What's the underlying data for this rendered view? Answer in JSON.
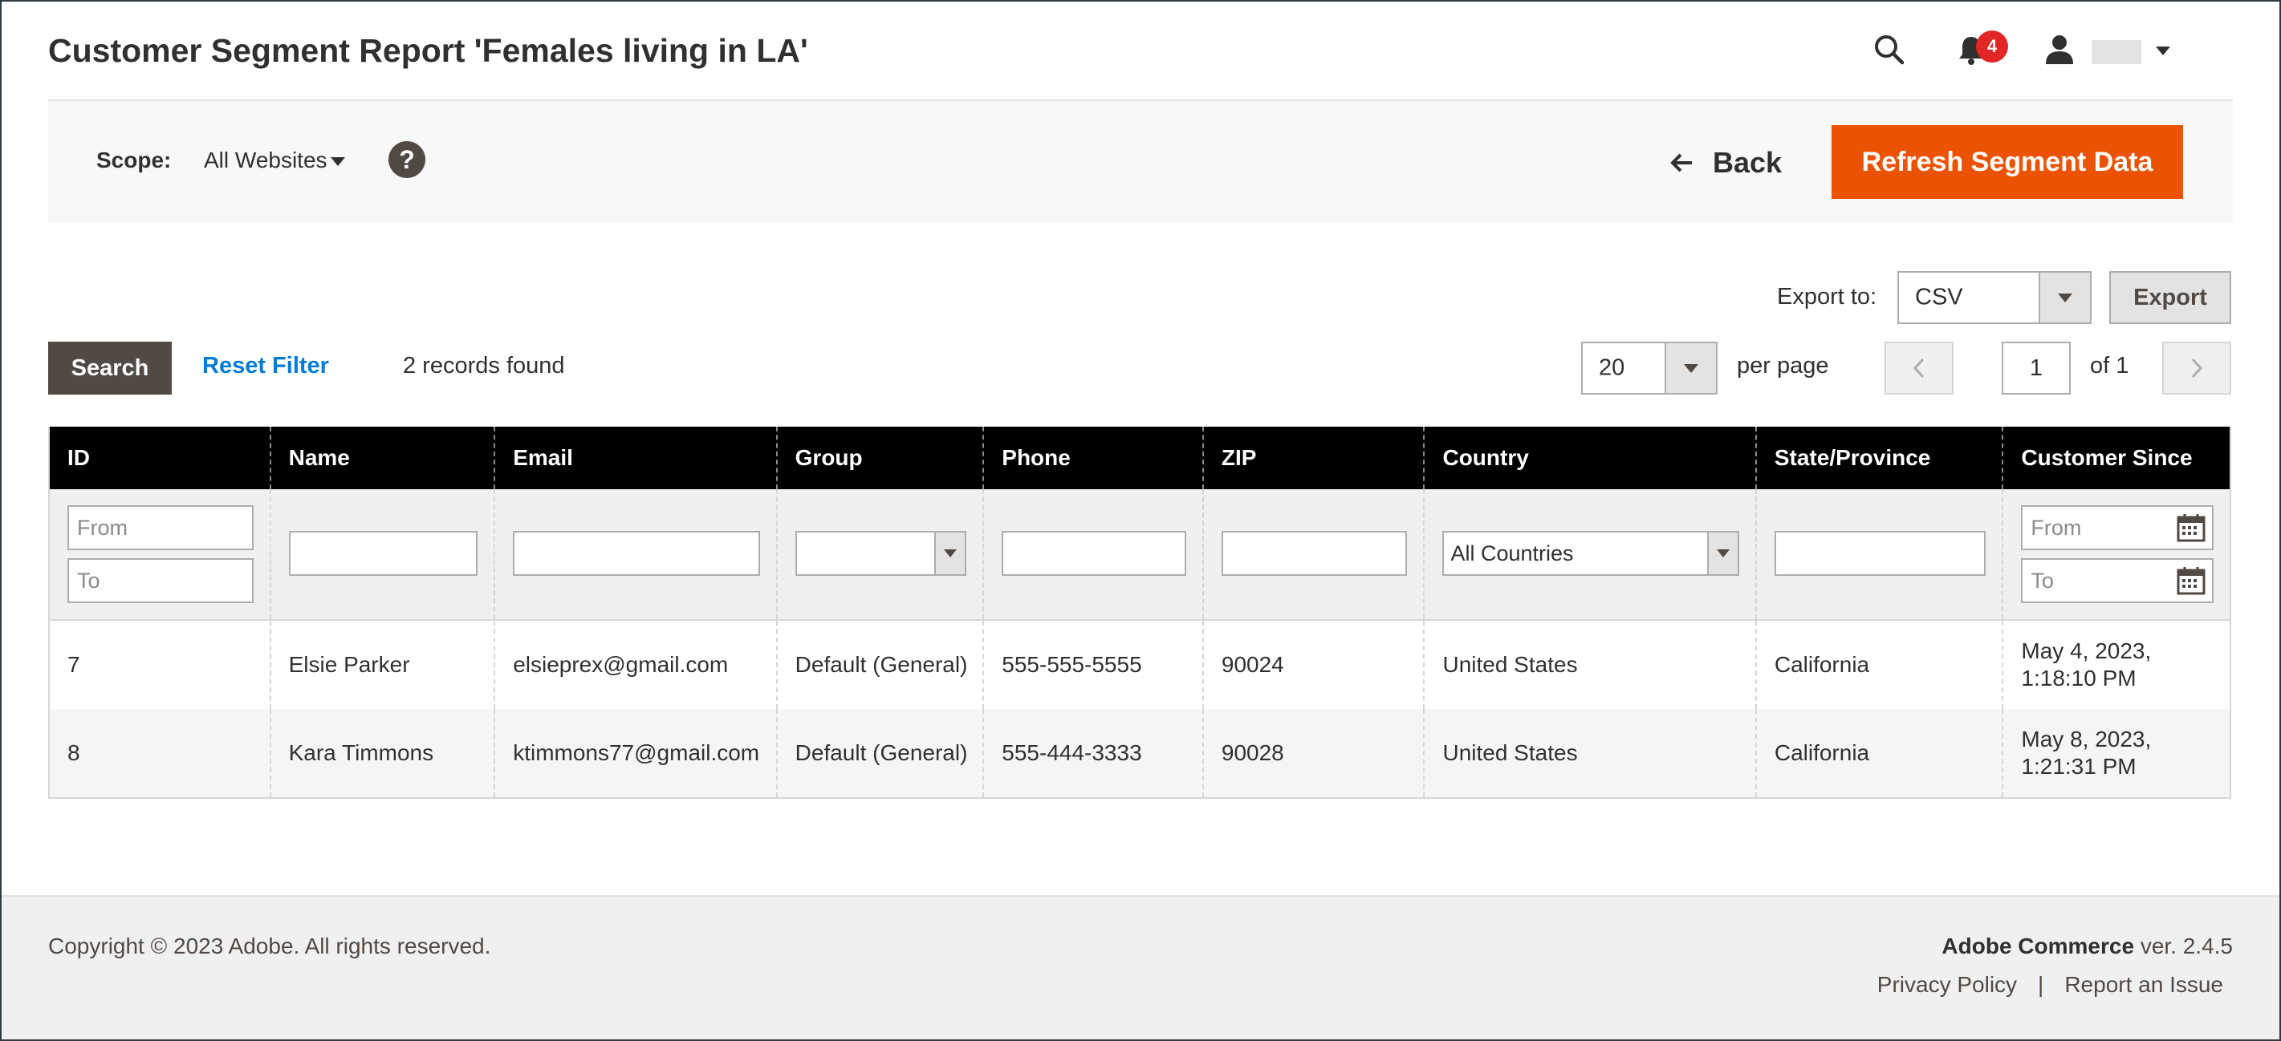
{
  "header": {
    "title": "Customer Segment Report 'Females living in LA'",
    "notifications_count": "4"
  },
  "scope": {
    "label": "Scope:",
    "value": "All Websites",
    "help": "?"
  },
  "actions": {
    "back_label": "Back",
    "refresh_label": "Refresh Segment Data"
  },
  "export": {
    "label": "Export to:",
    "format": "CSV",
    "button": "Export"
  },
  "toolbar": {
    "search_label": "Search",
    "reset_label": "Reset Filter",
    "records_found": "2 records found",
    "per_page_value": "20",
    "per_page_label": "per page",
    "page_current": "1",
    "page_of": "of 1"
  },
  "grid": {
    "columns": [
      "ID",
      "Name",
      "Email",
      "Group",
      "Phone",
      "ZIP",
      "Country",
      "State/Province",
      "Customer Since"
    ],
    "filters": {
      "id_from_placeholder": "From",
      "id_to_placeholder": "To",
      "country_value": "All Countries",
      "since_from_placeholder": "From",
      "since_to_placeholder": "To"
    },
    "rows": [
      {
        "id": "7",
        "name": "Elsie Parker",
        "email": "elsieprex@gmail.com",
        "group": "Default (General)",
        "phone": "555-555-5555",
        "zip": "90024",
        "country": "United States",
        "state": "California",
        "since_line1": "May 4, 2023,",
        "since_line2": "1:18:10 PM"
      },
      {
        "id": "8",
        "name": "Kara Timmons",
        "email": "ktimmons77@gmail.com",
        "group": "Default (General)",
        "phone": "555-444-3333",
        "zip": "90028",
        "country": "United States",
        "state": "California",
        "since_line1": "May 8, 2023,",
        "since_line2": "1:21:31 PM"
      }
    ]
  },
  "footer": {
    "copyright": "Copyright © 2023 Adobe. All rights reserved.",
    "product": "Adobe Commerce",
    "version": "ver. 2.4.5",
    "privacy": "Privacy Policy",
    "separator": "|",
    "report_issue": "Report an Issue"
  },
  "colors": {
    "accent": "#eb5202",
    "link": "#007bdb",
    "header_bg": "#000000",
    "button_dark": "#514943",
    "badge": "#e22626"
  }
}
